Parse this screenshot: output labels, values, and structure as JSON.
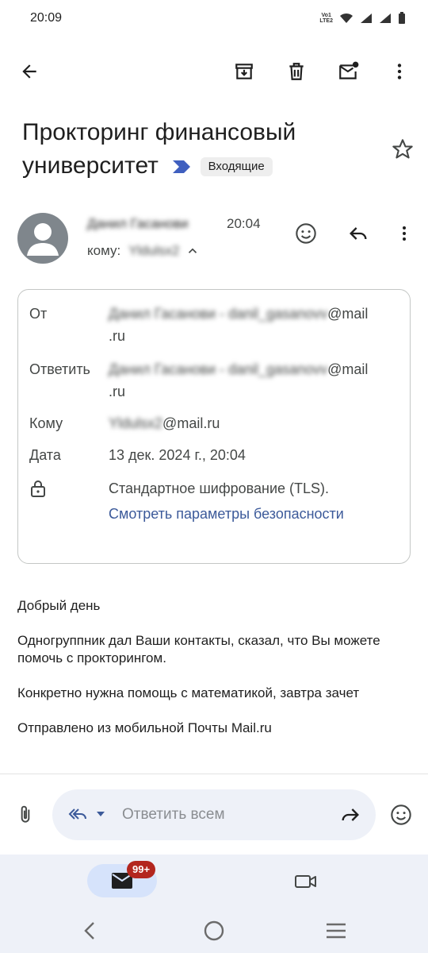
{
  "status": {
    "time": "20:09",
    "network_label": "VoLTE2"
  },
  "toolbar": {
    "back": "back-arrow-icon",
    "archive": "archive-icon",
    "delete": "trash-icon",
    "unread": "mark-unread-icon",
    "more": "more-vert-icon"
  },
  "email": {
    "subject": "Прокторинг финансовый университет",
    "label": "Входящие",
    "sender_name": "Данил Гасанови",
    "time": "20:04",
    "to_prefix": "кому:",
    "to_name": "Yldulsx2"
  },
  "details": {
    "from_label": "От",
    "from_value_blur": "Данил Гасанови - danil_gasanovv",
    "from_domain": "@mail",
    "from_domain2": ".ru",
    "reply_label": "Ответить",
    "reply_value_blur": "Данил Гасанови - danil_gasanovv",
    "reply_domain": "@mail",
    "reply_domain2": ".ru",
    "to_label": "Кому",
    "to_value_blur": "Yldulsx2",
    "to_domain": "@mail.ru",
    "date_label": "Дата",
    "date_value": "13 дек. 2024 г., 20:04",
    "encryption": "Стандартное шифрование (TLS).",
    "security_link": "Смотреть параметры безопасности"
  },
  "body": {
    "p1": "Добрый день",
    "p2": "Одногруппник дал Ваши контакты, сказал, что Вы можете помочь с прокторингом.",
    "p3": "Конкретно нужна помощь с математикой, завтра зачет",
    "p4": "Отправлено из мобильной Почты Mail.ru"
  },
  "reply": {
    "placeholder": "Ответить всем"
  },
  "nav": {
    "badge": "99+"
  },
  "colors": {
    "accent": "#3c5a9a",
    "nav_bg": "#eef1f8",
    "badge": "#b3261e"
  }
}
